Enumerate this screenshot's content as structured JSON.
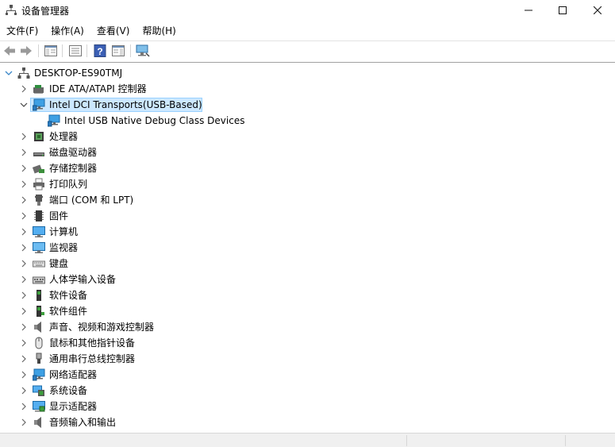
{
  "window": {
    "title": "设备管理器"
  },
  "menu": [
    "文件(F)",
    "操作(A)",
    "查看(V)",
    "帮助(H)"
  ],
  "toolbar": [
    "back-icon",
    "forward-icon",
    "show-hide-console-tree-icon",
    "properties-icon",
    "help-icon",
    "show-action-pane-icon",
    "scan-hardware-icon"
  ],
  "tree": {
    "root": {
      "label": "DESKTOP-ES90TMJ",
      "icon": "computer-root-icon",
      "expanded": true
    },
    "items": [
      {
        "label": "IDE ATA/ATAPI 控制器",
        "icon": "ide-controller-icon",
        "expanded": false
      },
      {
        "label": "Intel DCI Transports(USB-Based)",
        "icon": "network-monitor-icon",
        "expanded": true,
        "selected": true,
        "children": [
          {
            "label": "Intel USB Native Debug Class Devices",
            "icon": "network-monitor-icon"
          }
        ]
      },
      {
        "label": "处理器",
        "icon": "processor-icon",
        "expanded": false
      },
      {
        "label": "磁盘驱动器",
        "icon": "disk-drive-icon",
        "expanded": false
      },
      {
        "label": "存储控制器",
        "icon": "storage-controller-icon",
        "expanded": false
      },
      {
        "label": "打印队列",
        "icon": "printer-icon",
        "expanded": false
      },
      {
        "label": "端口 (COM 和 LPT)",
        "icon": "port-icon",
        "expanded": false
      },
      {
        "label": "固件",
        "icon": "firmware-icon",
        "expanded": false
      },
      {
        "label": "计算机",
        "icon": "computer-icon",
        "expanded": false
      },
      {
        "label": "监视器",
        "icon": "monitor-icon",
        "expanded": false
      },
      {
        "label": "键盘",
        "icon": "keyboard-icon",
        "expanded": false
      },
      {
        "label": "人体学输入设备",
        "icon": "hid-icon",
        "expanded": false
      },
      {
        "label": "软件设备",
        "icon": "software-device-icon",
        "expanded": false
      },
      {
        "label": "软件组件",
        "icon": "software-component-icon",
        "expanded": false
      },
      {
        "label": "声音、视频和游戏控制器",
        "icon": "speaker-icon",
        "expanded": false
      },
      {
        "label": "鼠标和其他指针设备",
        "icon": "mouse-icon",
        "expanded": false
      },
      {
        "label": "通用串行总线控制器",
        "icon": "usb-icon",
        "expanded": false
      },
      {
        "label": "网络适配器",
        "icon": "network-adapter-icon",
        "expanded": false
      },
      {
        "label": "系统设备",
        "icon": "system-device-icon",
        "expanded": false
      },
      {
        "label": "显示适配器",
        "icon": "display-adapter-icon",
        "expanded": false
      },
      {
        "label": "音频输入和输出",
        "icon": "audio-io-icon",
        "expanded": false
      }
    ]
  },
  "colors": {
    "selection_bg": "#cce8ff",
    "selection_border": "#99d1ff",
    "icon_blue": "#1e88d2"
  }
}
